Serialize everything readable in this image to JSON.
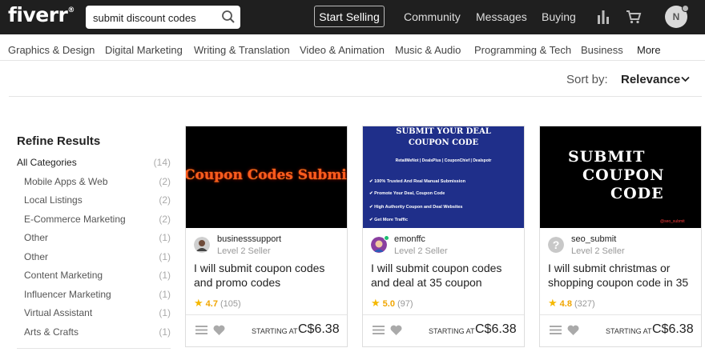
{
  "header": {
    "logo": "fiverr",
    "logo_mark": "®",
    "search_value": "submit discount codes",
    "start_selling": "Start Selling",
    "nav": [
      "Community",
      "Messages",
      "Buying"
    ],
    "avatar_initial": "N"
  },
  "categories": [
    "Graphics & Design",
    "Digital Marketing",
    "Writing & Translation",
    "Video & Animation",
    "Music & Audio",
    "Programming & Tech",
    "Business",
    "More"
  ],
  "sort": {
    "label": "Sort by:",
    "value": "Relevance"
  },
  "sidebar": {
    "title": "Refine Results",
    "items": [
      {
        "label": "All Categories",
        "count": "(14)"
      },
      {
        "label": "Mobile Apps & Web",
        "count": "(2)"
      },
      {
        "label": "Local Listings",
        "count": "(2)"
      },
      {
        "label": "E-Commerce Marketing",
        "count": "(2)"
      },
      {
        "label": "Other",
        "count": "(1)"
      },
      {
        "label": "Other",
        "count": "(1)"
      },
      {
        "label": "Content Marketing",
        "count": "(1)"
      },
      {
        "label": "Influencer Marketing",
        "count": "(1)"
      },
      {
        "label": "Virtual Assistant",
        "count": "(1)"
      },
      {
        "label": "Arts & Crafts",
        "count": "(1)"
      }
    ]
  },
  "gigs": [
    {
      "thumb_text": "Coupon Codes Submission",
      "seller": "businesssupport",
      "level": "Level 2 Seller",
      "title": "I will submit coupon codes and promo codes",
      "rating": "4.7",
      "reviews": "(105)",
      "starting": "STARTING AT",
      "price": "C$6.38"
    },
    {
      "thumb_title1": "SUBMIT YOUR DEAL",
      "thumb_title2": "COUPON CODE",
      "thumb_sites": "RetailMeNot | DealsPlus | CouponChief | Dealspotr",
      "thumb_bullets": [
        "100% Trusted And Real Manual Submission",
        "Promote Your Deal, Coupon Code",
        "High Authority Coupon and Deal Websites",
        "Get More Traffic"
      ],
      "seller": "emonffc",
      "level": "Level 2 Seller",
      "title": "I will submit coupon codes and deal at 35 coupon",
      "rating": "5.0",
      "reviews": "(97)",
      "starting": "STARTING AT",
      "price": "C$6.38"
    },
    {
      "thumb_lines": [
        "SUBMIT",
        "COUPON",
        "CODE"
      ],
      "thumb_handle": "@seo_submit",
      "seller": "seo_submit",
      "level": "Level 2 Seller",
      "title": "I will submit christmas or shopping coupon code in 35",
      "rating": "4.8",
      "reviews": "(327)",
      "starting": "STARTING AT",
      "price": "C$6.38"
    }
  ],
  "colors": {
    "topbar": "#1f1f1f",
    "star": "#f5b800",
    "thumb_blue": "#1f2f8a",
    "thumb_orange": "#ff5a1f"
  }
}
